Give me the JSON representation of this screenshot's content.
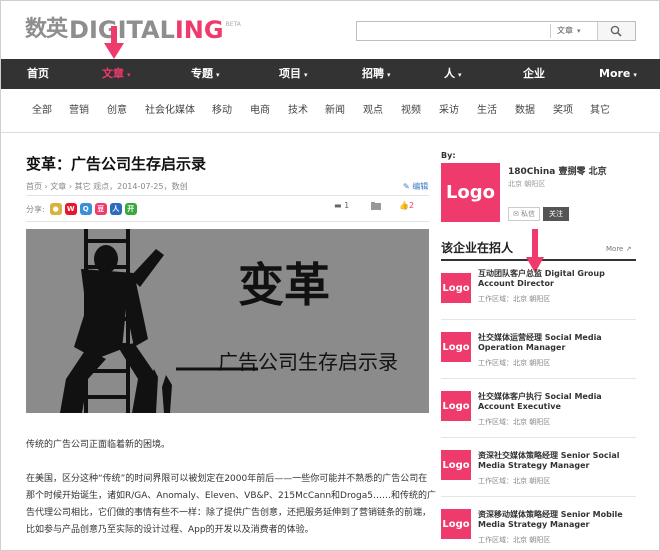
{
  "header": {
    "logo_cn": "数英",
    "logo_en_main": "DIGITAL",
    "logo_en_accent": "ING",
    "logo_beta": "BETA",
    "search_scope": "文章"
  },
  "main_nav": [
    {
      "label": "首页",
      "dropdown": false
    },
    {
      "label": "文章",
      "dropdown": true,
      "active": true
    },
    {
      "label": "专题",
      "dropdown": true
    },
    {
      "label": "项目",
      "dropdown": true
    },
    {
      "label": "招聘",
      "dropdown": true
    },
    {
      "label": "人",
      "dropdown": true
    },
    {
      "label": "企业",
      "dropdown": false
    },
    {
      "label": "More",
      "dropdown": true
    }
  ],
  "sub_nav": [
    "全部",
    "营销",
    "创意",
    "社会化媒体",
    "移动",
    "电商",
    "技术",
    "新闻",
    "观点",
    "视频",
    "采访",
    "生活",
    "数据",
    "奖项",
    "其它"
  ],
  "article": {
    "title": "变革：广告公司生存启示录",
    "meta": "首页 › 文章 › 其它 观点，2014-07-25，数创",
    "edit": "编辑",
    "share_label": "分享:",
    "comments": "1",
    "likes": "2",
    "hero_title": "变革",
    "hero_subtitle": "广告公司生存启示录",
    "p1": "传统的广告公司正面临着新的困境。",
    "p2": "在美国，区分这种“传统”的时间界限可以被划定在2000年前后——一些你可能并不熟悉的广告公司在那个时候开始诞生，诸如R/GA、Anomaly、Eleven、VB&P、215McCann和Droga5……和传统的广告代理公司相比，它们做的事情有些不一样：除了提供广告创意，还把服务延伸到了营销链条的前端，比如参与产品创意乃至实际的设计过程、App的开发以及消费者的体验。"
  },
  "sidebar": {
    "by_label": "By:",
    "company_logo": "Logo",
    "company_name": "180China 壹捌零 北京",
    "company_location": "北京 朝阳区",
    "msg_button": "私信",
    "follow_button": "关注",
    "jobs_title": "该企业在招人",
    "jobs_more": "More",
    "jobs": [
      {
        "logo": "Logo",
        "title": "互动团队客户总监 Digital Group Account Director",
        "location": "工作区域：北京 朝阳区"
      },
      {
        "logo": "Logo",
        "title": "社交媒体运营经理 Social Media Operation Manager",
        "location": "工作区域：北京 朝阳区"
      },
      {
        "logo": "Logo",
        "title": "社交媒体客户执行 Social Media Account Executive",
        "location": "工作区域：北京 朝阳区"
      },
      {
        "logo": "Logo",
        "title": "资深社交媒体策略经理 Senior Social Media Strategy Manager",
        "location": "工作区域：北京 朝阳区"
      },
      {
        "logo": "Logo",
        "title": "资深移动媒体策略经理 Senior Mobile Media Strategy Manager",
        "location": "工作区域：北京 朝阳区"
      }
    ]
  },
  "colors": {
    "accent": "#ee3a6c",
    "nav_bg": "#333333",
    "arrow": "#ee3a6c"
  }
}
